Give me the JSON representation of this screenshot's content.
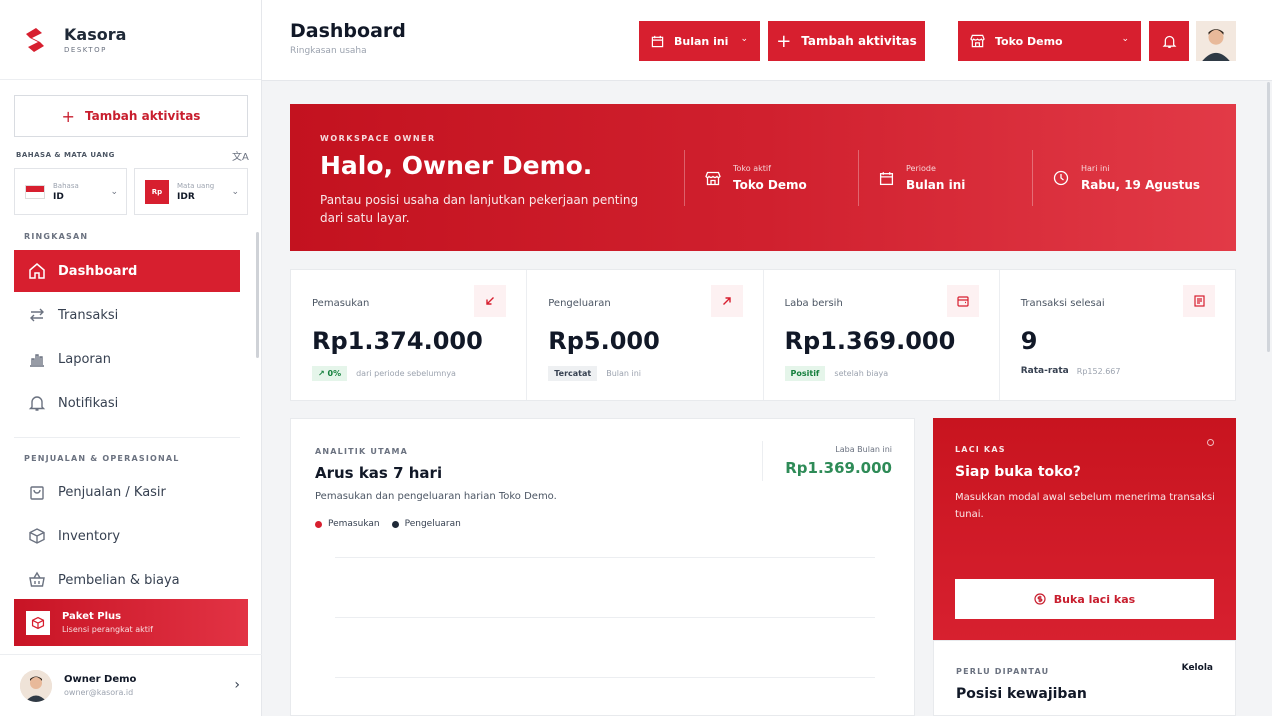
{
  "brand": {
    "name": "Kasora",
    "subtitle": "DESKTOP"
  },
  "sidebar": {
    "add_label": "Tambah aktivitas",
    "lang_section": "BAHASA & MATA UANG",
    "language": {
      "label": "Bahasa",
      "value": "ID"
    },
    "currency": {
      "badge": "Rp",
      "label": "Mata uang",
      "value": "IDR"
    },
    "section_summary": "RINGKASAN",
    "section_ops": "PENJUALAN & OPERASIONAL",
    "items": [
      {
        "label": "Dashboard"
      },
      {
        "label": "Transaksi"
      },
      {
        "label": "Laporan"
      },
      {
        "label": "Notifikasi"
      },
      {
        "label": "Penjualan / Kasir"
      },
      {
        "label": "Inventory"
      },
      {
        "label": "Pembelian & biaya"
      }
    ],
    "plan": {
      "title": "Paket Plus",
      "subtitle": "Lisensi perangkat aktif"
    },
    "user": {
      "name": "Owner Demo",
      "email": "owner@kasora.id"
    }
  },
  "header": {
    "title": "Dashboard",
    "subtitle": "Ringkasan usaha",
    "period_label": "Bulan ini",
    "add_label": "Tambah aktivitas",
    "store_label": "Toko Demo"
  },
  "hero": {
    "kicker": "WORKSPACE OWNER",
    "title": "Halo, Owner Demo.",
    "description": "Pantau posisi usaha dan lanjutkan pekerjaan penting dari satu layar.",
    "items": [
      {
        "label": "Toko aktif",
        "value": "Toko Demo"
      },
      {
        "label": "Periode",
        "value": "Bulan ini"
      },
      {
        "label": "Hari ini",
        "value": "Rabu, 19 Agustus"
      }
    ]
  },
  "stats": [
    {
      "label": "Pemasukan",
      "value": "Rp1.374.000",
      "chip": "0%",
      "note": "dari periode sebelumnya"
    },
    {
      "label": "Pengeluaran",
      "value": "Rp5.000",
      "chip": "Tercatat",
      "note": "Bulan ini"
    },
    {
      "label": "Laba bersih",
      "value": "Rp1.369.000",
      "chip": "Positif",
      "note": "setelah biaya"
    },
    {
      "label": "Transaksi selesai",
      "value": "9",
      "strong": "Rata-rata",
      "note": "Rp152.667"
    }
  ],
  "analytics": {
    "kicker": "ANALITIK UTAMA",
    "title": "Arus kas 7 hari",
    "description": "Pemasukan dan pengeluaran harian Toko Demo.",
    "legend": [
      {
        "label": "Pemasukan",
        "color": "#d71f2f"
      },
      {
        "label": "Pengeluaran",
        "color": "#1f2937"
      }
    ],
    "profit_label": "Laba Bulan ini",
    "profit_value": "Rp1.369.000"
  },
  "cash_drawer": {
    "kicker": "LACI KAS",
    "title": "Siap buka toko?",
    "description": "Masukkan modal awal sebelum menerima transaksi tunai.",
    "button": "Buka laci kas"
  },
  "watch": {
    "kicker": "PERLU DIPANTAU",
    "action": "Kelola",
    "title": "Posisi kewajiban"
  },
  "colors": {
    "accent": "#d71f2f",
    "positive": "#2e8b57"
  }
}
